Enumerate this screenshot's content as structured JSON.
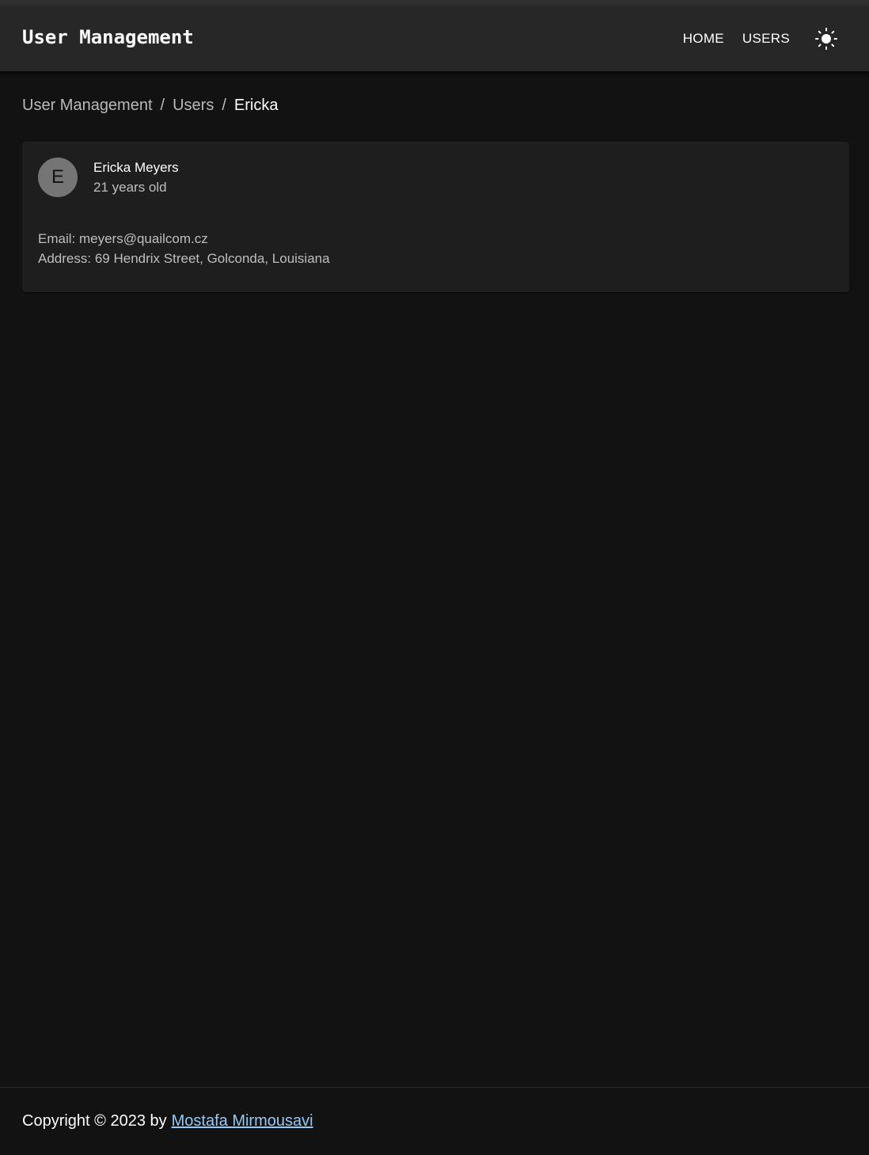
{
  "header": {
    "title": "User Management",
    "nav": [
      {
        "label": "HOME"
      },
      {
        "label": "USERS"
      }
    ],
    "theme_toggle_icon": "sun-icon"
  },
  "breadcrumb": {
    "items": [
      "User Management",
      "Users"
    ],
    "separator": "/",
    "current": "Ericka"
  },
  "user": {
    "avatar_initial": "E",
    "name": "Ericka Meyers",
    "age_text": "21 years old",
    "email_label": "Email:",
    "email": "meyers@quailcom.cz",
    "address_label": "Address:",
    "address": "69 Hendrix Street, Golconda, Louisiana"
  },
  "footer": {
    "copyright": "Copyright © 2023 by",
    "author": "Mostafa Mirmousavi"
  },
  "colors": {
    "background": "#121212",
    "appbar": "#272727",
    "card": "#1e1e1e",
    "avatar": "#757575",
    "link": "#90caf9"
  }
}
